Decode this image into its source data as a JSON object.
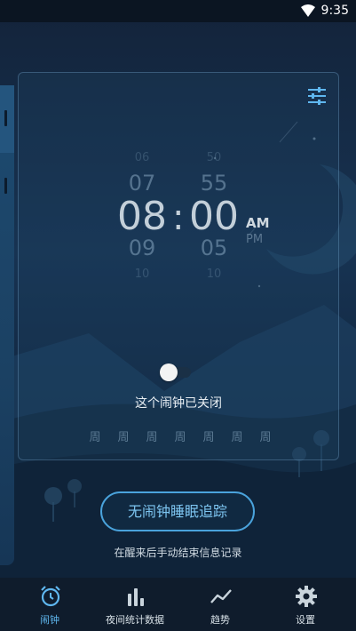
{
  "status_bar": {
    "time": "9:35"
  },
  "alarm": {
    "hours": {
      "far_above": "06",
      "above": "07",
      "current": "08",
      "below": "09",
      "far_below": "10"
    },
    "minutes": {
      "far_above": "50",
      "above": "55",
      "current": "00",
      "below": "05",
      "far_below": "10"
    },
    "separator": ":",
    "am_label": "AM",
    "pm_label": "PM",
    "status_text": "这个闹钟已关闭",
    "weekdays": [
      "周",
      "周",
      "周",
      "周",
      "周",
      "周",
      "周"
    ]
  },
  "sleep_tracking": {
    "button_label": "无闹钟睡眠追踪",
    "hint": "在醒来后手动结束信息记录"
  },
  "bottom_nav": {
    "items": [
      {
        "label": "闹钟",
        "icon": "alarm-clock-icon",
        "active": true
      },
      {
        "label": "夜间统计数据",
        "icon": "bar-chart-icon",
        "active": false
      },
      {
        "label": "趋势",
        "icon": "trend-line-icon",
        "active": false
      },
      {
        "label": "设置",
        "icon": "gear-icon",
        "active": false
      }
    ]
  },
  "colors": {
    "accent": "#4aa3dc",
    "active_nav": "#5fb7ef"
  }
}
